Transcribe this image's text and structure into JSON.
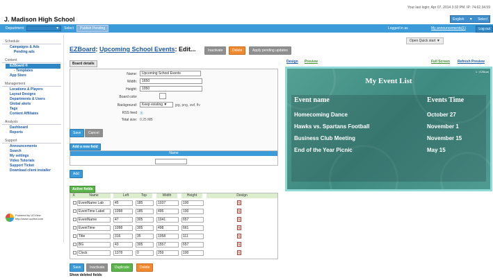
{
  "header": {
    "last_login": "Your last login: Apr 07, 2014 3:32 PM. IP: 74.62.34.59",
    "school": "J. Madison High School",
    "language": "English",
    "language_select": "Select"
  },
  "bluebar": {
    "department_label": "Department",
    "select_label": "Select",
    "publish_label": "Publish Pending",
    "logged_in": "Logged in as",
    "announcements": "My announcements(1)",
    "logout": "Log out"
  },
  "sidebar": {
    "sections": [
      {
        "head": "Schedule",
        "items": [
          "Campaigns & Ads",
          "Pending ads"
        ]
      },
      {
        "head": "Content",
        "items": [
          "EZBoard ®",
          "- Templates",
          "App Store"
        ]
      },
      {
        "head": "Management",
        "items": [
          "Locations & Players",
          "Layout Designs",
          "Departments & Users",
          "Global alerts",
          "Tags",
          "Content Affiliates"
        ]
      },
      {
        "head": "Analysis",
        "items": [
          "Dashboard",
          "Reports"
        ]
      },
      {
        "head": "Support",
        "items": [
          "Announcements",
          "Search",
          "My settings",
          "Video Tutorials",
          "Support Ticket",
          "Download client installer"
        ]
      }
    ],
    "powered_by": "Powered by UCView",
    "powered_url": "http://www.ucview.com"
  },
  "main": {
    "title_prefix": "EZBoard",
    "title_sep": ":",
    "title_link": "Upcoming School Events",
    "title_suffix": ": Edit...",
    "btn_inactivate": "Inactivate",
    "btn_delete": "Delete",
    "btn_apply": "Apply pending updates",
    "quick_start": "Open Quick start ▼",
    "details_head": "Board details",
    "details": {
      "name_label": "Name:",
      "name_value": "Upcoming School Events",
      "width_label": "Width:",
      "width_value": "1650",
      "height_label": "Height:",
      "height_value": "1050",
      "color_label": "Board color",
      "bg_label": "Background:",
      "bg_value": "Keep existing ▼",
      "bg_hint": "jpg, png, swf, flv",
      "rss_label": "RSS feed",
      "rss_value": "⦿",
      "size_label": "Total size:",
      "size_value": "0.25 MB"
    },
    "btn_save": "Save",
    "btn_cancel": "Cancel",
    "add_head": "Add a new field",
    "add_col_name": "Name",
    "btn_add": "Add",
    "active_head": "Active fields",
    "active_cols": [
      "X",
      "Name",
      "Left",
      "Top",
      "Width",
      "Height",
      "Design"
    ],
    "active_rows": [
      {
        "name": "EventName Lab",
        "left": "45",
        "top": "185",
        "width": "1037",
        "height": "100"
      },
      {
        "name": "EventTime Label",
        "left": "1098",
        "top": "185",
        "width": "495",
        "height": "100"
      },
      {
        "name": "EventName",
        "left": "47",
        "top": "305",
        "width": "1041",
        "height": "657"
      },
      {
        "name": "EventTime",
        "left": "1098",
        "top": "305",
        "width": "498",
        "height": "661"
      },
      {
        "name": "Title",
        "left": "316",
        "top": "35",
        "width": "1058",
        "height": "111"
      },
      {
        "name": "BG",
        "left": "43",
        "top": "305",
        "width": "1557",
        "height": "657"
      },
      {
        "name": "Clock",
        "left": "1378",
        "top": "0",
        "width": "259",
        "height": "100"
      }
    ],
    "btn_save2": "Save",
    "btn_inactivate2": "Inactivate",
    "btn_duplicate": "Duplicate",
    "btn_delete2": "Delete",
    "show_deleted": "Show deleted fields"
  },
  "preview": {
    "tab_design": "Design",
    "tab_preview": "Preview",
    "full_screen": "Full Screen",
    "refresh": "Refresh Preview",
    "corner": "1 : EZBoar",
    "title": "My Event List",
    "col_name": "Event name",
    "col_time": "Events Time",
    "rows": [
      {
        "name": "Homecoming Dance",
        "time": "October 27"
      },
      {
        "name": "Hawks vs. Spartans Football",
        "time": "November 1"
      },
      {
        "name": "Business Club Meeting",
        "time": "November  15"
      },
      {
        "name": "End of the Year Picnic",
        "time": "May 15"
      }
    ]
  }
}
